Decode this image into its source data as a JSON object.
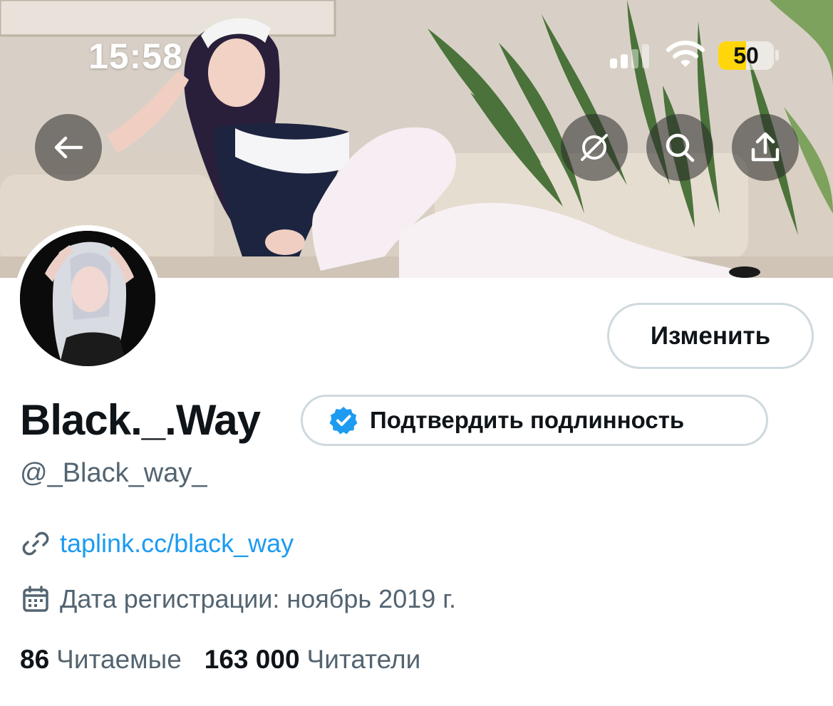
{
  "status_bar": {
    "time": "15:58",
    "battery_level": "50",
    "battery_color": "#ffd60a",
    "icons": [
      "cellular-signal-icon",
      "wifi-icon",
      "battery-icon"
    ]
  },
  "banner_buttons": {
    "back": "arrow-left-icon",
    "translate": "translate-icon",
    "search": "search-icon",
    "share": "share-icon"
  },
  "profile": {
    "display_name": "Black._.Way",
    "handle": "@_Black_way_",
    "edit_label": "Изменить",
    "verify_label": "Подтвердить подлинность",
    "verified_badge_color": "#1d9bf0",
    "link_text": "taplink.cc/black_way",
    "join_date": "Дата регистрации: ноябрь 2019 г.",
    "following_count": "86",
    "following_label": "Читаемые",
    "followers_count": "163 000",
    "followers_label": "Читатели"
  },
  "colors": {
    "accent": "#1d9bf0",
    "text_primary": "#0f1419",
    "text_secondary": "#536471",
    "border": "#cfd9de"
  }
}
